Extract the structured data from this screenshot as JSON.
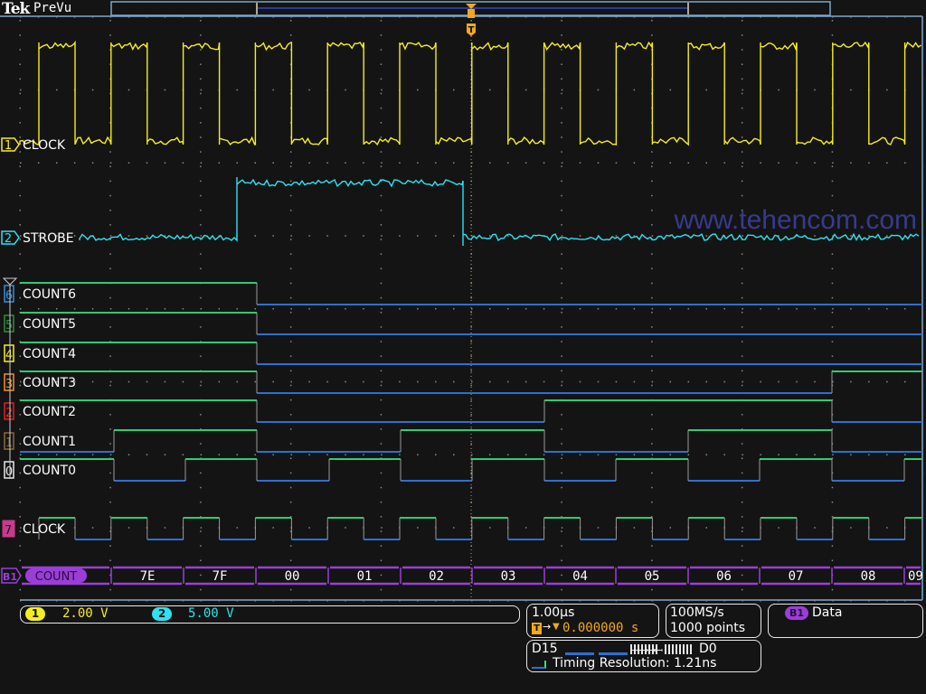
{
  "header": {
    "brand": "Tek",
    "mode": "PreVu"
  },
  "trigger": {
    "marker_label": "T"
  },
  "watermark": "www.tehencom.com",
  "analog_channels": [
    {
      "num": "1",
      "name": "CLOCK",
      "color": "#f5ee1f",
      "scale": "2.00 V"
    },
    {
      "num": "2",
      "name": "STROBE",
      "color": "#2ee2f0",
      "scale": "5.00 V"
    }
  ],
  "digital_channels": [
    {
      "num": "6",
      "name": "COUNT6",
      "badge_color": "#2f8fd8"
    },
    {
      "num": "5",
      "name": "COUNT5",
      "badge_color": "#2e8c3e"
    },
    {
      "num": "4",
      "name": "COUNT4",
      "badge_color": "#f5ee1f"
    },
    {
      "num": "3",
      "name": "COUNT3",
      "badge_color": "#f0902a"
    },
    {
      "num": "2",
      "name": "COUNT2",
      "badge_color": "#e02020"
    },
    {
      "num": "1",
      "name": "COUNT1",
      "badge_color": "#8a6a3a"
    },
    {
      "num": "0",
      "name": "COUNT0",
      "badge_color": "#e8e8e8"
    },
    {
      "num": "7",
      "name": "CLOCK",
      "badge_color": "#c83a8c"
    }
  ],
  "bus": {
    "id": "B1",
    "name": "COUNT",
    "color": "#9a3ed8",
    "values": [
      "7E",
      "7F",
      "00",
      "01",
      "02",
      "03",
      "04",
      "05",
      "06",
      "07",
      "08",
      "09"
    ]
  },
  "status": {
    "horizontal_scale": "1.00µs",
    "trigger_position": "0.000000 s",
    "sample_rate": "100MS/s",
    "record_length": "1000 points",
    "bus_label": "B1",
    "bus_type": "Data",
    "digital_range_high": "D15",
    "digital_range_low": "D0",
    "timing_resolution": "Timing Resolution: 1.21ns"
  }
}
